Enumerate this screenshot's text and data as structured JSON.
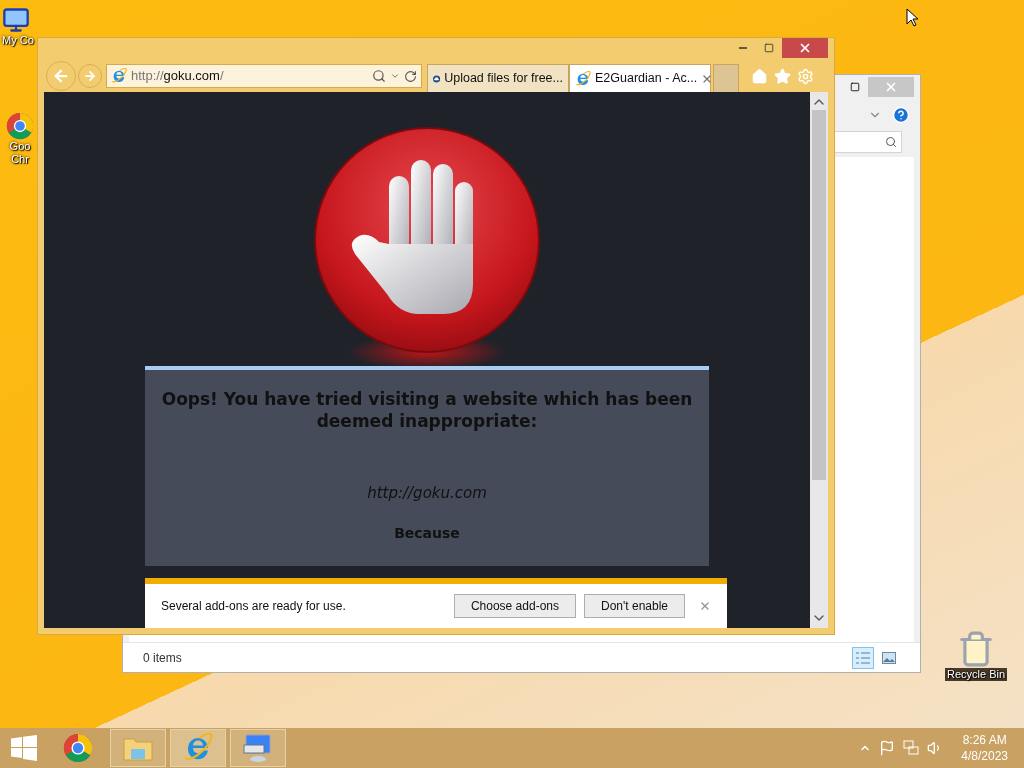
{
  "desktop_icons": [
    {
      "kind": "computer",
      "label_lines": [
        "My Co"
      ]
    },
    {
      "kind": "chrome",
      "label_lines": [
        "Goo",
        "Chr"
      ]
    },
    {
      "kind": "recycle",
      "label_lines": [
        "Recycle Bin"
      ]
    }
  ],
  "explorer": {
    "status": "0 items",
    "views": [
      {
        "kind": "details",
        "selected": true
      },
      {
        "kind": "preview",
        "selected": false
      }
    ]
  },
  "browser": {
    "address": {
      "prefix": "http://",
      "domain": "goku.com",
      "suffix": "/"
    },
    "tabs": [
      {
        "kind": "cloud",
        "title": "Upload files for free...",
        "selected": false
      },
      {
        "kind": "ie",
        "title": "E2Guardian - Ac...",
        "selected": true
      }
    ],
    "page": {
      "heading": "Oops! You have tried visiting a website which has been deemed inappropriate:",
      "url": "http://goku.com",
      "reason_label": "Because"
    },
    "notification": {
      "message": "Several add-ons are ready for use.",
      "buttons": [
        "Choose add-ons",
        "Don't enable"
      ]
    }
  },
  "taskbar": {
    "apps": [
      {
        "kind": "chrome",
        "running": false,
        "selected": false
      },
      {
        "kind": "explorer",
        "running": true,
        "selected": false
      },
      {
        "kind": "ie",
        "running": true,
        "selected": true
      },
      {
        "kind": "remote",
        "running": true,
        "selected": false
      }
    ],
    "clock": {
      "time": "8:26 AM",
      "date": "4/8/2023"
    }
  }
}
